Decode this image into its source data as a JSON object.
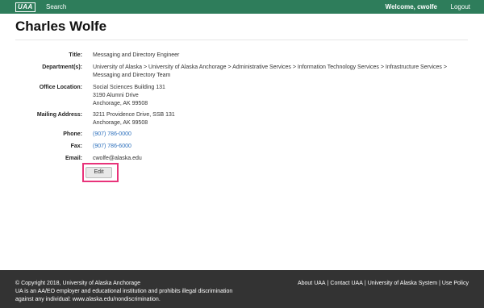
{
  "header": {
    "logo_text": "UAA",
    "search_label": "Search",
    "welcome_text": "Welcome, cwolfe",
    "logout_label": "Logout"
  },
  "profile": {
    "name": "Charles Wolfe",
    "fields": {
      "title": {
        "label": "Title:",
        "value": "Messaging and Directory Engineer"
      },
      "departments": {
        "label": "Department(s):",
        "lines": [
          "University of Alaska > University of Alaska Anchorage > Administrative Services > Information Technology Services > Infrastructure Services >",
          "Messaging and Directory Team"
        ]
      },
      "office": {
        "label": "Office Location:",
        "lines": [
          "Social Sciences Building 131",
          "3190 Alumni Drive",
          "Anchorage, AK 99508"
        ]
      },
      "mailing": {
        "label": "Mailing Address:",
        "lines": [
          "3211 Providence Drive, SSB 131",
          "Anchorage, AK 99508"
        ]
      },
      "phone": {
        "label": "Phone:",
        "value": "(907) 786-0000"
      },
      "fax": {
        "label": "Fax:",
        "value": "(907) 786-6000"
      },
      "email": {
        "label": "Email:",
        "value": "cwolfe@alaska.edu"
      }
    },
    "edit_label": "Edit"
  },
  "footer": {
    "left_lines": [
      "© Copyright 2018, University of Alaska Anchorage",
      "UA is an AA/EO employer and educational institution and prohibits illegal discrimination",
      "against any individual: www.alaska.edu/nondiscrimination."
    ],
    "links": [
      "About UAA",
      "Contact UAA",
      "University of Alaska System",
      "Use Policy"
    ],
    "separator": "|"
  },
  "colors": {
    "header_bg": "#2e7d5b",
    "footer_bg": "#333333",
    "link": "#2a6ebb",
    "highlight": "#e8337a"
  }
}
